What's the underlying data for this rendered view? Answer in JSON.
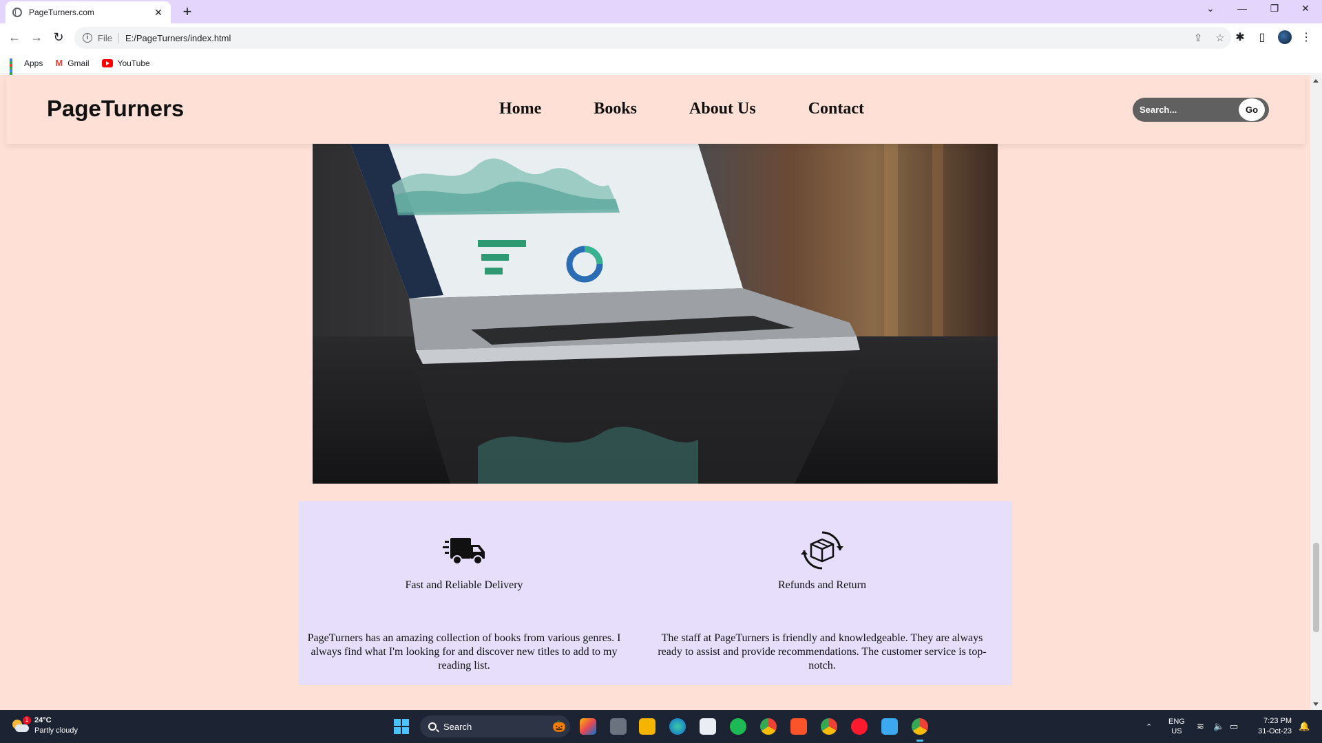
{
  "browser": {
    "tab_title": "PageTurners.com",
    "tab_close": "✕",
    "new_tab": "+",
    "window_controls": [
      "⌄",
      "—",
      "❐",
      "✕"
    ],
    "url_scheme": "File",
    "url": "E:/PageTurners/index.html",
    "bookmarks": [
      {
        "label": "Apps",
        "icon": "apps-icon"
      },
      {
        "label": "Gmail",
        "icon": "gmail-icon"
      },
      {
        "label": "YouTube",
        "icon": "youtube-icon"
      }
    ],
    "toolbar_icons": [
      "back-icon",
      "forward-icon",
      "reload-icon",
      "share-icon",
      "star-icon",
      "extensions-icon",
      "side-panel-icon",
      "profile-icon",
      "menu-icon"
    ]
  },
  "site": {
    "logo": "PageTurners",
    "nav": [
      "Home",
      "Books",
      "About Us",
      "Contact"
    ],
    "search_placeholder": "Search...",
    "search_button": "Go",
    "colors": {
      "page_bg": "#ffe0d6",
      "feature_bg": "#e7defb",
      "search_bg": "#606060"
    }
  },
  "features": [
    {
      "icon": "delivery-truck-icon",
      "title": "Fast and Reliable Delivery",
      "text": "PageTurners has an amazing collection of books from various genres. I always find what I'm looking for and discover new titles to add to my reading list."
    },
    {
      "icon": "refund-box-icon",
      "title": "Refunds and Return",
      "text": "The staff at PageTurners is friendly and knowledgeable. They are always ready to assist and provide recommendations. The customer service is top-notch."
    }
  ],
  "taskbar": {
    "weather_temp": "24°C",
    "weather_desc": "Partly cloudy",
    "weather_badge": "1",
    "search_label": "Search",
    "lang_1": "ENG",
    "lang_2": "US",
    "time": "7:23 PM",
    "date": "31-Oct-23"
  }
}
